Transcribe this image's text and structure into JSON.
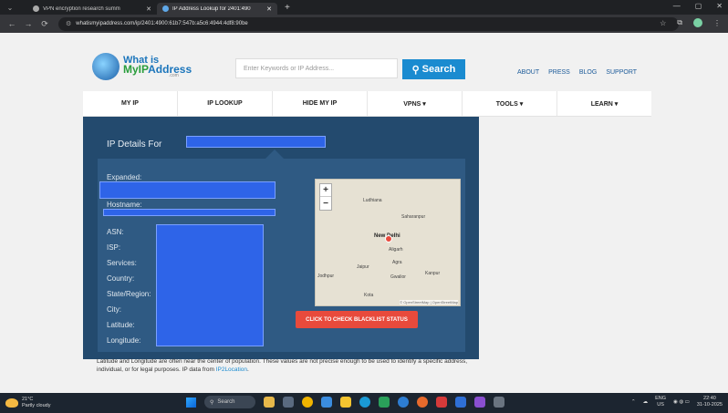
{
  "browser": {
    "tabs": [
      {
        "title": "VPN encryption research summ",
        "active": false
      },
      {
        "title": "IP Address Lookup for 2401:490",
        "active": true
      }
    ],
    "url": "whatismyipaddress.com/ip/2401:4900:61b7:547b:a5c6:4944:4df8:90be"
  },
  "site": {
    "logo": {
      "line1": "What is",
      "line2_my": "MyIP",
      "line2_rest": "Address",
      "line3": ".com"
    },
    "search_placeholder": "Enter Keywords or IP Address...",
    "search_button": "Search",
    "top_links": [
      "ABOUT",
      "PRESS",
      "BLOG",
      "SUPPORT"
    ],
    "nav": [
      "MY IP",
      "IP LOOKUP",
      "HIDE MY IP",
      "VPNS ▾",
      "TOOLS ▾",
      "LEARN ▾"
    ]
  },
  "details": {
    "title": "IP Details For",
    "labels": {
      "expanded": "Expanded:",
      "hostname": "Hostname:",
      "asn": "ASN:",
      "isp": "ISP:",
      "services": "Services:",
      "country": "Country:",
      "state": "State/Region:",
      "city": "City:",
      "latitude": "Latitude:",
      "longitude": "Longitude:"
    },
    "map": {
      "zoom_in": "+",
      "zoom_out": "−",
      "cities": [
        "Ludhiana",
        "Saharanpur",
        "New Delhi",
        "Aligarh",
        "Agra",
        "Jaipur",
        "Gwalior",
        "Kanpur",
        "Jodhpur",
        "Kota"
      ],
      "attribution": "© OpenStreetMap | OpenStreetMap"
    },
    "blacklist_button": "CLICK TO CHECK BLACKLIST STATUS"
  },
  "disclaimer": {
    "text": "Latitude and Longitude are often near the center of population. These values are not precise enough to be used to identify a specific address, individual, or for legal purposes. IP data from ",
    "link": "IP2Location",
    "end": "."
  },
  "taskbar": {
    "weather_temp": "21°C",
    "weather_desc": "Partly cloudy",
    "search": "Search",
    "lang1": "ENG",
    "lang2": "US",
    "time": "22:40",
    "date": "31-10-2025"
  }
}
